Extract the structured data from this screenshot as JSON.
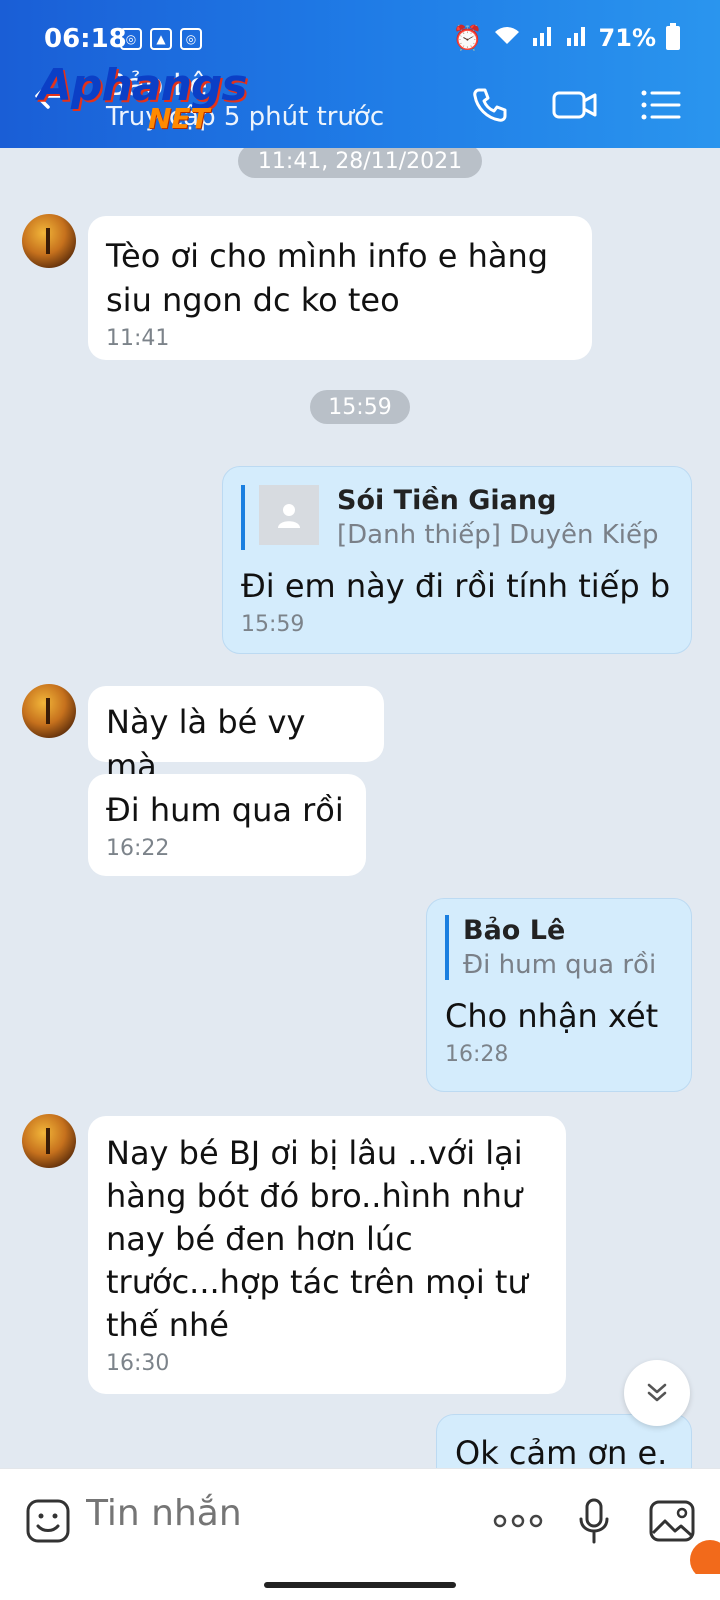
{
  "status_bar": {
    "time": "06:18",
    "battery": "71%"
  },
  "header": {
    "contact_name": "Bảo Lê",
    "status": "Truy cập 5 phút trước"
  },
  "watermark": {
    "part1": "Aphangs",
    "part2": "NET"
  },
  "chat": {
    "date_pill_1": "11:41, 28/11/2021",
    "date_pill_2": "15:59",
    "msg1": {
      "text": "Tèo ơi cho mình info e hàng siu ngon dc ko teo",
      "time": "11:41"
    },
    "msg2": {
      "quote_name": "Sói Tiền Giang",
      "quote_text": "[Danh thiếp] Duyên Kiếp",
      "text": "Đi em này đi rồi tính tiếp b",
      "time": "15:59"
    },
    "msg3": {
      "text": "Này là bé vy mà"
    },
    "msg4": {
      "text": "Đi hum qua rồi",
      "time": "16:22"
    },
    "msg5": {
      "quote_name": "Bảo Lê",
      "quote_text": "Đi hum qua rồi",
      "text": "Cho nhận xét",
      "time": "16:28"
    },
    "msg6": {
      "text": "Nay bé BJ ơi bị lâu ..với lại hàng bót đó bro..hình như nay bé đen hơn lúc trước...hợp tác trên mọi tư thế nhé",
      "time": "16:30"
    },
    "msg7": {
      "text": "Ok cảm ơn e."
    }
  },
  "input": {
    "placeholder": "Tin nhắn"
  }
}
